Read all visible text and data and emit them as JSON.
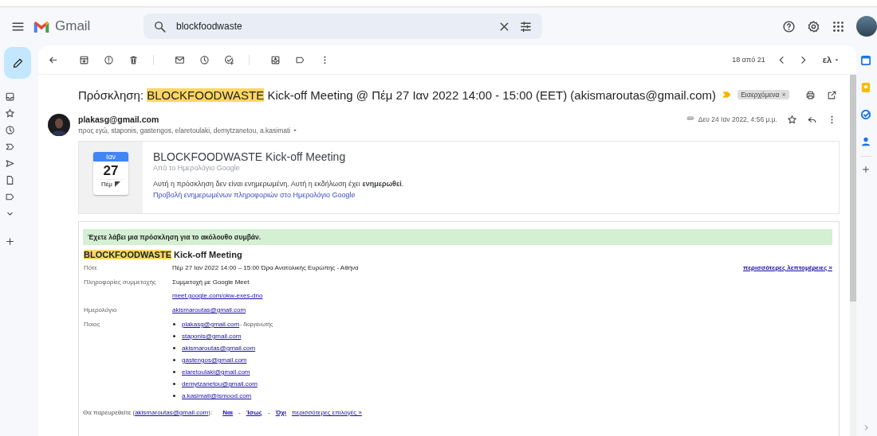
{
  "app": {
    "name": "Gmail"
  },
  "search": {
    "value": "blockfoodwaste"
  },
  "toolbar": {
    "pagination": "18 από 21",
    "input_tool": "ελ"
  },
  "subject": {
    "segments": [
      {
        "text": "Πρόσκληση: ",
        "highlight": false
      },
      {
        "text": "BLOCKFOODWASTE",
        "highlight": true
      },
      {
        "text": " Kick-off Meeting @ Πέμ 27 Ιαν 2022 14:00 - 15:00 (EET) (akismaroutas@gmail.com)",
        "highlight": false
      }
    ],
    "important": true,
    "label": {
      "text": "Εισερχόμενα",
      "close": "×"
    }
  },
  "message": {
    "sender": "plakasg@gmail.com",
    "recipients": "προς εγώ, staponis, gastengos, elaretoulaki, demytzanetou, a.kasimati",
    "date": "Δευ 24 Ιαν 2022, 4:56 μ.μ.",
    "starred": false
  },
  "calendar_card": {
    "month": "Ιαν",
    "day": "27",
    "weekday": "Πέμ",
    "title": "BLOCKFOODWASTE Kick-off Meeting",
    "source": "Από το Ημερολόγιο Google",
    "notice": "Αυτή η πρόσκληση δεν είναι ενημερωμένη. Αυτή η εκδήλωση έχει **ενημερωθεί**.",
    "link": "Προβολή ενημερωμένων πληροφοριών στο Ημερολόγιο Google"
  },
  "invitation": {
    "banner": "Έχετε λάβει μια πρόσκληση για το ακόλουθο συμβάν.",
    "title": [
      {
        "text": "BLOCKFOODWASTE",
        "highlight": true
      },
      {
        "text": " Kick-off Meeting",
        "highlight": false
      }
    ],
    "more_details": "περισσότερες λεπτομέρειες »",
    "rows": [
      {
        "label": "Πότε",
        "kind": "text",
        "values": [
          "Πέμ 27 Ιαν 2022 14:00 – 15:00 Ώρα Ανατολικής Ευρώπης - Αθήνα"
        ]
      },
      {
        "label": "Πληροφορίες συμμετοχής",
        "kind": "join",
        "values": [
          "Συμμετοχή με Google Meet",
          "meet.google.com/okw-exes-dno"
        ]
      },
      {
        "label": "Ημερολόγιο",
        "kind": "link",
        "values": [
          "akismaroutas@gmail.com"
        ]
      },
      {
        "label": "Ποιος",
        "kind": "guests",
        "guests": [
          {
            "email": "plakasg@gmail.com",
            "role": "- διοργανωτής"
          },
          {
            "email": "staponis@gmail.com"
          },
          {
            "email": "akismaroutas@gmail.com"
          },
          {
            "email": "gastengos@gmail.com"
          },
          {
            "email": "elaretoulaki@gmail.com"
          },
          {
            "email": "demytzanetou@gmail.com"
          },
          {
            "email": "a.kasimati@ismood.com"
          }
        ]
      }
    ],
    "rsvp": {
      "prompt": "Θα παρευρεθείτε (",
      "calendar": "akismaroutas@gmail.com",
      "suffix": "):",
      "options": [
        "Ναι",
        "Ίσως",
        "Όχι"
      ],
      "separators": [
        "-",
        "-"
      ],
      "more": "περισσότερες επιλογές »"
    }
  }
}
